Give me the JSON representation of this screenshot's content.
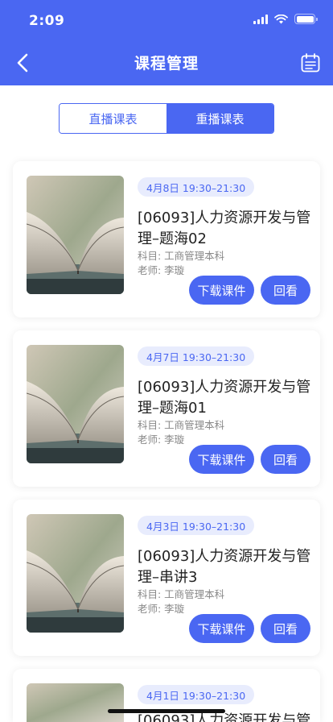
{
  "status_bar": {
    "time": "2:09"
  },
  "nav": {
    "title": "课程管理"
  },
  "tabs": [
    {
      "label": "直播课表",
      "active": false
    },
    {
      "label": "重播课表",
      "active": true
    }
  ],
  "courses": [
    {
      "time": "4月8日 19:30–21:30",
      "title": "[06093]人力资源开发与管理–题海02",
      "subject": "科目: 工商管理本科",
      "teacher": "老师: 李璇",
      "download_label": "下载课件",
      "replay_label": "回看"
    },
    {
      "time": "4月7日 19:30–21:30",
      "title": "[06093]人力资源开发与管理–题海01",
      "subject": "科目: 工商管理本科",
      "teacher": "老师: 李璇",
      "download_label": "下载课件",
      "replay_label": "回看"
    },
    {
      "time": "4月3日 19:30–21:30",
      "title": "[06093]人力资源开发与管理–串讲3",
      "subject": "科目: 工商管理本科",
      "teacher": "老师: 李璇",
      "download_label": "下载课件",
      "replay_label": "回看"
    },
    {
      "time": "4月1日 19:30–21:30",
      "title": "[06093]人力资源开发与管",
      "subject": "",
      "teacher": "",
      "download_label": "",
      "replay_label": ""
    }
  ],
  "colors": {
    "primary": "#4a67f2",
    "tag_bg": "#e8ecfd",
    "text": "#222222",
    "meta": "#888888"
  }
}
